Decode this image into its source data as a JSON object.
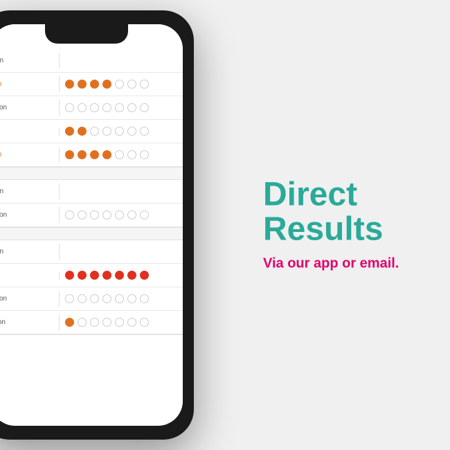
{
  "heading": {
    "line1": "Direct",
    "line2": "Results",
    "subtext": "Via our app or email."
  },
  "sections": [
    {
      "rows": [
        {
          "label": "on",
          "label_color": "normal",
          "dots": [
            0,
            0,
            0,
            0,
            0,
            0,
            0
          ]
        },
        {
          "label": "m",
          "label_color": "orange",
          "dots": [
            1,
            1,
            1,
            1,
            0,
            0,
            0
          ]
        },
        {
          "label": "tion",
          "label_color": "normal",
          "dots": [
            0,
            0,
            0,
            0,
            0,
            0,
            0
          ]
        },
        {
          "label": "",
          "label_color": "normal",
          "dots": [
            1,
            1,
            0,
            0,
            0,
            0,
            0
          ]
        },
        {
          "label": "m",
          "label_color": "orange",
          "dots": [
            1,
            1,
            1,
            1,
            0,
            0,
            0
          ]
        }
      ]
    },
    {
      "rows": [
        {
          "label": "on",
          "label_color": "normal",
          "dots": []
        },
        {
          "label": "tion",
          "label_color": "normal",
          "dots": [
            0,
            0,
            0,
            0,
            0,
            0,
            0
          ]
        }
      ]
    },
    {
      "rows": [
        {
          "label": "on",
          "label_color": "normal",
          "dots": []
        },
        {
          "label": "",
          "label_color": "red",
          "dots": [
            2,
            2,
            2,
            2,
            2,
            2,
            2
          ]
        },
        {
          "label": "tion",
          "label_color": "normal",
          "dots": [
            0,
            0,
            0,
            0,
            0,
            0,
            0
          ]
        },
        {
          "label": "",
          "label_color": "normal",
          "dots": [
            3,
            0,
            0,
            0,
            0,
            0,
            0
          ]
        }
      ]
    }
  ],
  "colors": {
    "teal": "#2aaa99",
    "pink": "#e0006a",
    "orange": "#e07020",
    "red": "#e03020"
  }
}
